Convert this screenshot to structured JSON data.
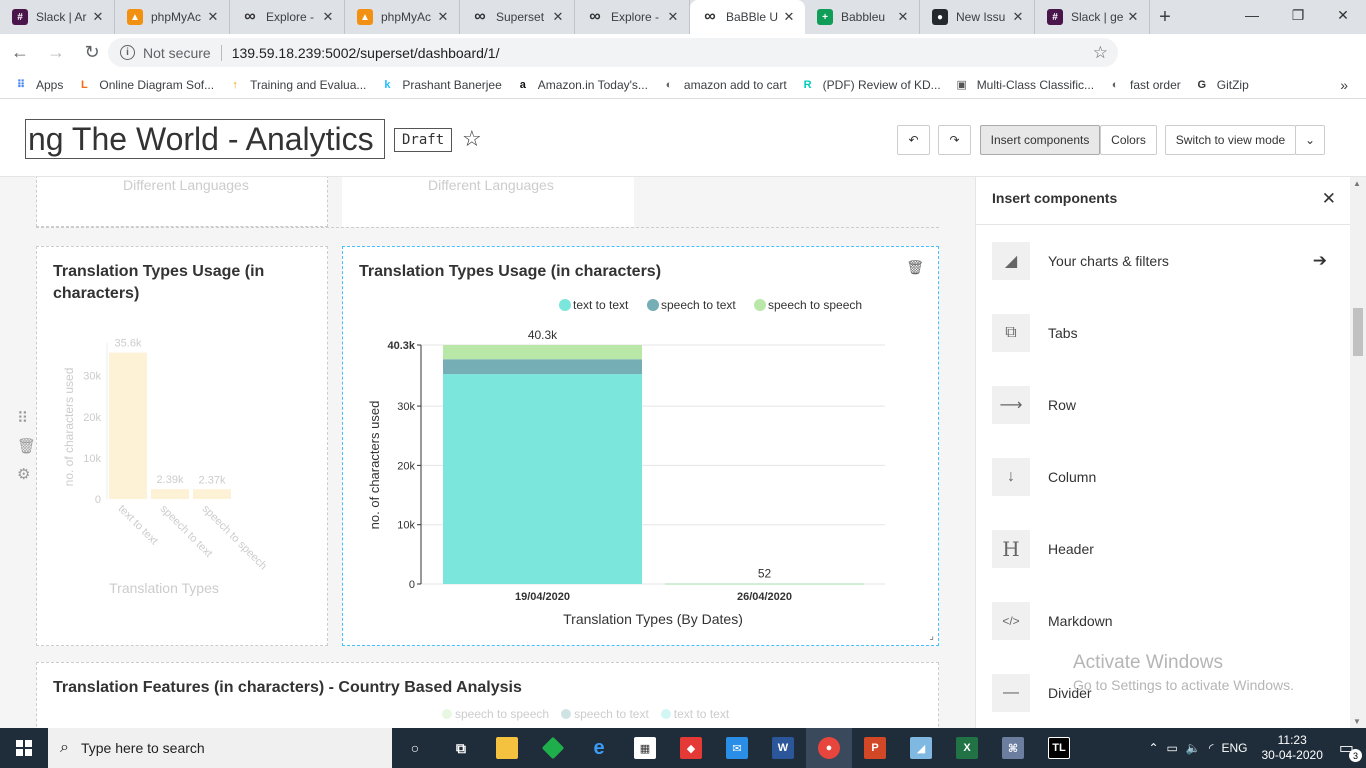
{
  "browser": {
    "tabs": [
      {
        "label": "Slack | Ar",
        "icon": "slack-icon",
        "color": "#4a154b"
      },
      {
        "label": "phpMyAc",
        "icon": "phpmyadmin-icon",
        "color": "#f29111"
      },
      {
        "label": "Explore -",
        "icon": "superset-icon",
        "color": "#333333"
      },
      {
        "label": "phpMyAc",
        "icon": "phpmyadmin-icon",
        "color": "#f29111"
      },
      {
        "label": "Superset",
        "icon": "superset-icon",
        "color": "#333333"
      },
      {
        "label": "Explore -",
        "icon": "superset-icon",
        "color": "#333333"
      },
      {
        "label": "BaBBle U",
        "icon": "superset-icon",
        "color": "#333333"
      },
      {
        "label": "Babbleu",
        "icon": "sheets-icon",
        "color": "#0f9d58"
      },
      {
        "label": "New Issu",
        "icon": "github-icon",
        "color": "#24292e"
      },
      {
        "label": "Slack | ge",
        "icon": "slack-icon",
        "color": "#4a154b"
      }
    ],
    "active_tab_index": 6,
    "security_label": "Not secure",
    "url": "139.59.18.239:5002/superset/dashboard/1/",
    "bookmarks": [
      {
        "label": "Apps",
        "icon": "apps-grid-icon",
        "color": "#4285f4"
      },
      {
        "label": "Online Diagram Sof...",
        "icon": "lucidchart-icon",
        "color": "#f96b13"
      },
      {
        "label": "Training and Evalua...",
        "icon": "training-icon",
        "color": "#f4a300"
      },
      {
        "label": "Prashant Banerjee",
        "icon": "kaggle-icon",
        "color": "#20beff"
      },
      {
        "label": "Amazon.in Today's...",
        "icon": "amazon-icon",
        "color": "#111111"
      },
      {
        "label": "amazon add to cart",
        "icon": "globe-icon",
        "color": "#5f6368"
      },
      {
        "label": "(PDF) Review of KD...",
        "icon": "researchgate-icon",
        "color": "#00ccbb"
      },
      {
        "label": "Multi-Class Classific...",
        "icon": "bookmark-image-icon",
        "color": "#555555"
      },
      {
        "label": "fast order",
        "icon": "globe-icon",
        "color": "#5f6368"
      },
      {
        "label": "GitZip",
        "icon": "gitzip-icon",
        "color": "#333333"
      }
    ]
  },
  "header": {
    "title": "ng  The World - Analytics",
    "draft_label": "Draft",
    "insert_components_label": "Insert components",
    "colors_label": "Colors",
    "switch_mode_label": "Switch to view mode"
  },
  "top_cards": {
    "left_caption": "Different Languages",
    "right_caption": "Different Languages"
  },
  "left_chart": {
    "title_line1": "Translation Types Usage (in",
    "title_line2": "characters)",
    "ylabel": "no. of characters used",
    "xlabel": "Translation Types",
    "yticks": [
      "30k",
      "20k",
      "10k",
      "0"
    ],
    "color": "#fdf1d6"
  },
  "main_chart": {
    "title": "Translation Types Usage (in characters)",
    "total_label_1": "40.3k",
    "total_label_2": "52"
  },
  "bottom_card": {
    "title": "Translation Features (in characters) - Country Based Analysis",
    "legend": [
      "speech to speech",
      "speech to text",
      "text to text"
    ]
  },
  "insert_panel": {
    "title": "Insert components",
    "items": [
      {
        "label": "Your charts & filters",
        "icon": "area-chart-icon"
      },
      {
        "label": "Tabs",
        "icon": "tabs-icon"
      },
      {
        "label": "Row",
        "icon": "row-arrow-icon"
      },
      {
        "label": "Column",
        "icon": "column-arrow-icon"
      },
      {
        "label": "Header",
        "icon": "header-h-icon"
      },
      {
        "label": "Markdown",
        "icon": "code-icon"
      },
      {
        "label": "Divider",
        "icon": "divider-icon"
      }
    ]
  },
  "watermark": {
    "line1": "Activate Windows",
    "line2": "Go to Settings to activate Windows."
  },
  "taskbar": {
    "search_placeholder": "Type here to search",
    "lang": "ENG",
    "time": "11:23",
    "date": "30-04-2020",
    "notification_count": "3"
  },
  "chart_data": [
    {
      "type": "bar",
      "title": "Translation Types Usage (in characters)",
      "xlabel": "Translation Types",
      "ylabel": "no. of characters used",
      "categories": [
        "text to text",
        "speech to text",
        "speech to speech"
      ],
      "values": [
        35600,
        2390,
        2370
      ],
      "data_labels": [
        "35.6k",
        "2.39k",
        "2.37k"
      ],
      "ylim": [
        0,
        36000
      ]
    },
    {
      "type": "bar",
      "stacked": true,
      "title": "Translation Types Usage (in characters)",
      "xlabel": "Translation Types (By Dates)",
      "ylabel": "no. of characters used",
      "categories": [
        "19/04/2020",
        "26/04/2020"
      ],
      "series": [
        {
          "name": "text to text",
          "values": [
            35400,
            40
          ],
          "color": "#7ae6dc"
        },
        {
          "name": "speech to text",
          "values": [
            2500,
            6
          ],
          "color": "#76aeb5"
        },
        {
          "name": "speech to speech",
          "values": [
            2400,
            6
          ],
          "color": "#b9e7a8"
        }
      ],
      "totals": [
        40300,
        52
      ],
      "yticks": [
        "40.3k",
        "30k",
        "20k",
        "10k",
        "0"
      ],
      "ylim": [
        0,
        40300
      ],
      "legend": "top"
    }
  ]
}
